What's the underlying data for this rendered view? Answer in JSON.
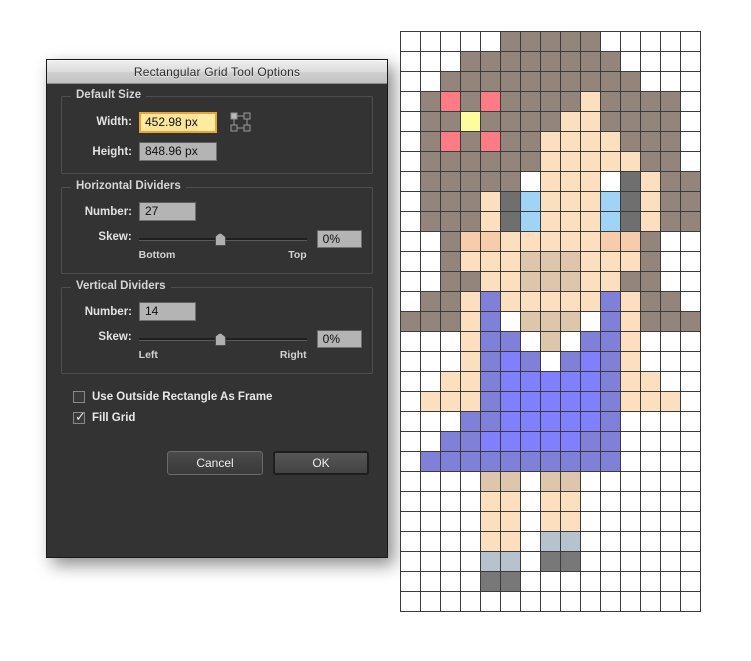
{
  "dialog": {
    "title": "Rectangular Grid Tool Options",
    "groups": {
      "default_size": {
        "legend": "Default Size",
        "width_label": "Width:",
        "width_value": "452.98 px",
        "height_label": "Height:",
        "height_value": "848.96 px",
        "reference_point_icon": "reference-point-icon"
      },
      "horizontal_dividers": {
        "legend": "Horizontal Dividers",
        "number_label": "Number:",
        "number_value": "27",
        "skew_label": "Skew:",
        "skew_value": "0%",
        "skew_min_label": "Bottom",
        "skew_max_label": "Top"
      },
      "vertical_dividers": {
        "legend": "Vertical Dividers",
        "number_label": "Number:",
        "number_value": "14",
        "skew_label": "Skew:",
        "skew_value": "0%",
        "skew_min_label": "Left",
        "skew_max_label": "Right"
      }
    },
    "checkboxes": [
      {
        "label": "Use Outside Rectangle As Frame",
        "checked": false
      },
      {
        "label": "Fill Grid",
        "checked": true
      }
    ],
    "buttons": {
      "cancel": "Cancel",
      "ok": "OK"
    },
    "colors": {
      "background": "#333333",
      "titlebar": "#dcdcdc",
      "field": "#b4b4b4",
      "highlight_field": "#ffec9e",
      "highlight_border": "#e8a33d"
    }
  },
  "canvas": {
    "grid": {
      "columns": 15,
      "rows": 29,
      "cell_size_px": 20,
      "line_color": "#3a3a3a",
      "palette": {
        ".": "#ffffff",
        "H": "#93857c",
        "S": "#fbdfbe",
        "S2": "#f6ccab",
        "S3": "#ddc6ab",
        "P": "#fd7b85",
        "Y": "#fdfd9e",
        "E": "#9fd4f7",
        "K": "#6f6f6f",
        "B": "#8080d8",
        "B2": "#8080ff",
        "G": "#b6c3ce",
        "D": "#787878"
      },
      "pixels": [
        ".....HHHHH.....",
        "...HHHHHHHH....",
        "..HHHHHHHHHH...",
        ".HPHPHHHHSHHHH.",
        ".HHYHHHHSSHHHH.",
        ".HPHPHHSSSSHHH.",
        ".HHHHHHSSSSSHH.",
        ".HHHHH.SSS.KSHH.",
        ".HHHSKESSSEKSHH",
        ".HHHSKESSSEKSHH",
        "..HS2S2SSSSS2S2H..",
        "..HSSS3S3S3SSH..",
        "..HHSS3S3S3SHH..",
        ".HHSBSSSSBSHH..",
        "HHHSB.S3S3S3.BSHHH",
        "...SBB.S3.BBS...",
        "...SBB2B.BB2BS..",
        "..SSBB2B2B2B2BSS..",
        ".SSSBB2B2B2B2BSSS.",
        "...BB2B2B2B2B....",
        "..BB2B2B2B2B2B...",
        ".BBBBBBBBBB....",
        "....S3S3.S3S3.....",
        "....SS.SS......",
        "....SS.SS......",
        "....SS.GG......",
        "....GG.DD......",
        "....DD.........",
        "..............."
      ]
    }
  }
}
